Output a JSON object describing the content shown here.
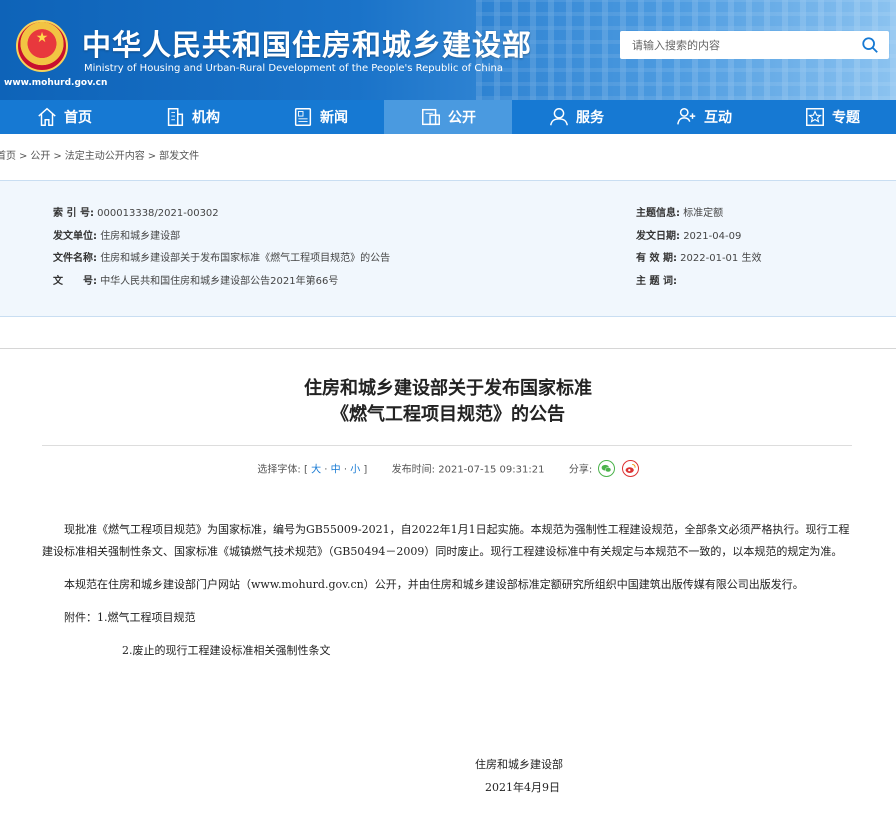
{
  "header": {
    "title": "中华人民共和国住房和城乡建设部",
    "subtitle": "Ministry of Housing and Urban-Rural Development of the People's Republic of China",
    "url": "www.mohurd.gov.cn",
    "search_placeholder": "请输入搜索的内容",
    "search_icon": "search-icon"
  },
  "nav": [
    {
      "label": "首页",
      "icon": "home-icon"
    },
    {
      "label": "机构",
      "icon": "building-icon"
    },
    {
      "label": "新闻",
      "icon": "news-icon"
    },
    {
      "label": "公开",
      "icon": "open-icon",
      "active": true
    },
    {
      "label": "服务",
      "icon": "service-icon"
    },
    {
      "label": "互动",
      "icon": "interact-icon"
    },
    {
      "label": "专题",
      "icon": "topic-icon"
    }
  ],
  "breadcrumb": [
    "首页",
    "公开",
    "法定主动公开内容",
    "部发文件"
  ],
  "info": {
    "index_label": "索 引 号:",
    "index_value": "000013338/2021-00302",
    "issuer_label": "发文单位:",
    "issuer_value": "住房和城乡建设部",
    "docname_label": "文件名称:",
    "docname_value": "住房和城乡建设部关于发布国家标准《燃气工程项目规范》的公告",
    "docno_label": "文　　号:",
    "docno_value": "中华人民共和国住房和城乡建设部公告2021年第66号",
    "topic_label": "主题信息:",
    "topic_value": "标准定额",
    "date_label": "发文日期:",
    "date_value": "2021-04-09",
    "valid_label": "有 效 期:",
    "valid_value": "2022-01-01 生效",
    "keywords_label": "主 题 词:",
    "keywords_value": ""
  },
  "article": {
    "title_line1": "住房和城乡建设部关于发布国家标准",
    "title_line2": "《燃气工程项目规范》的公告",
    "font_label": "选择字体:",
    "font_large": "大",
    "font_medium": "中",
    "font_small": "小",
    "publish_label": "发布时间:",
    "publish_time": "2021-07-15 09:31:21",
    "share_label": "分享:",
    "paragraph1": "现批准《燃气工程项目规范》为国家标准，编号为GB55009-2021，自2022年1月1日起实施。本规范为强制性工程建设规范，全部条文必须严格执行。现行工程建设标准相关强制性条文、国家标准《城镇燃气技术规范》（GB50494－2009）同时废止。现行工程建设标准中有关规定与本规范不一致的，以本规范的规定为准。",
    "paragraph2": "本规范在住房和城乡建设部门户网站（www.mohurd.gov.cn）公开，并由住房和城乡建设部标准定额研究所组织中国建筑出版传媒有限公司出版发行。",
    "attachment1": "附件：1.燃气工程项目规范",
    "attachment2": "2.废止的现行工程建设标准相关强制性条文",
    "signer": "住房和城乡建设部",
    "sign_date": "2021年4月9日"
  },
  "colors": {
    "nav_bg": "#1679d3",
    "nav_active": "#4a9ae0",
    "info_bg": "#f1f7fd",
    "link": "#1679d3"
  }
}
